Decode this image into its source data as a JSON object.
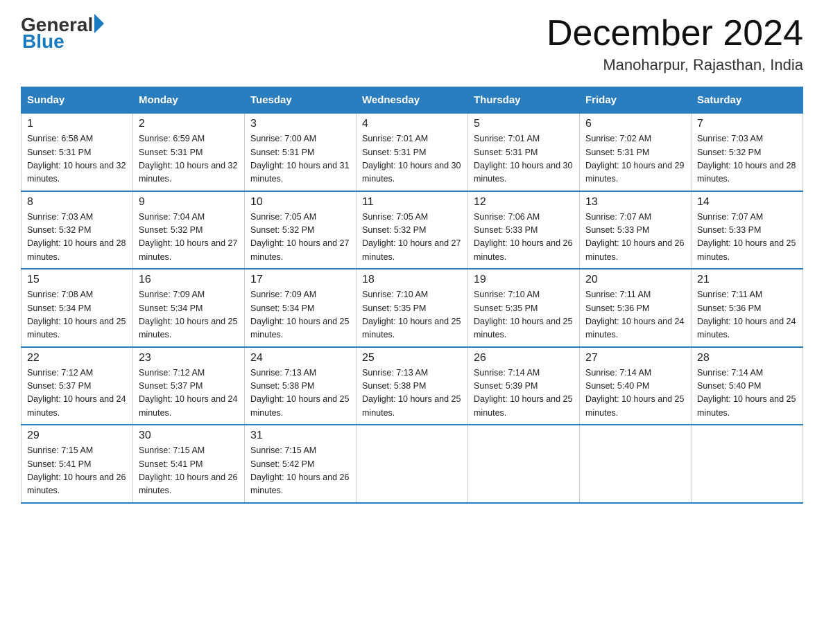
{
  "logo": {
    "general": "General",
    "blue": "Blue"
  },
  "title": "December 2024",
  "subtitle": "Manoharpur, Rajasthan, India",
  "weekdays": [
    "Sunday",
    "Monday",
    "Tuesday",
    "Wednesday",
    "Thursday",
    "Friday",
    "Saturday"
  ],
  "weeks": [
    [
      {
        "day": "1",
        "sunrise": "6:58 AM",
        "sunset": "5:31 PM",
        "daylight": "10 hours and 32 minutes."
      },
      {
        "day": "2",
        "sunrise": "6:59 AM",
        "sunset": "5:31 PM",
        "daylight": "10 hours and 32 minutes."
      },
      {
        "day": "3",
        "sunrise": "7:00 AM",
        "sunset": "5:31 PM",
        "daylight": "10 hours and 31 minutes."
      },
      {
        "day": "4",
        "sunrise": "7:01 AM",
        "sunset": "5:31 PM",
        "daylight": "10 hours and 30 minutes."
      },
      {
        "day": "5",
        "sunrise": "7:01 AM",
        "sunset": "5:31 PM",
        "daylight": "10 hours and 30 minutes."
      },
      {
        "day": "6",
        "sunrise": "7:02 AM",
        "sunset": "5:31 PM",
        "daylight": "10 hours and 29 minutes."
      },
      {
        "day": "7",
        "sunrise": "7:03 AM",
        "sunset": "5:32 PM",
        "daylight": "10 hours and 28 minutes."
      }
    ],
    [
      {
        "day": "8",
        "sunrise": "7:03 AM",
        "sunset": "5:32 PM",
        "daylight": "10 hours and 28 minutes."
      },
      {
        "day": "9",
        "sunrise": "7:04 AM",
        "sunset": "5:32 PM",
        "daylight": "10 hours and 27 minutes."
      },
      {
        "day": "10",
        "sunrise": "7:05 AM",
        "sunset": "5:32 PM",
        "daylight": "10 hours and 27 minutes."
      },
      {
        "day": "11",
        "sunrise": "7:05 AM",
        "sunset": "5:32 PM",
        "daylight": "10 hours and 27 minutes."
      },
      {
        "day": "12",
        "sunrise": "7:06 AM",
        "sunset": "5:33 PM",
        "daylight": "10 hours and 26 minutes."
      },
      {
        "day": "13",
        "sunrise": "7:07 AM",
        "sunset": "5:33 PM",
        "daylight": "10 hours and 26 minutes."
      },
      {
        "day": "14",
        "sunrise": "7:07 AM",
        "sunset": "5:33 PM",
        "daylight": "10 hours and 25 minutes."
      }
    ],
    [
      {
        "day": "15",
        "sunrise": "7:08 AM",
        "sunset": "5:34 PM",
        "daylight": "10 hours and 25 minutes."
      },
      {
        "day": "16",
        "sunrise": "7:09 AM",
        "sunset": "5:34 PM",
        "daylight": "10 hours and 25 minutes."
      },
      {
        "day": "17",
        "sunrise": "7:09 AM",
        "sunset": "5:34 PM",
        "daylight": "10 hours and 25 minutes."
      },
      {
        "day": "18",
        "sunrise": "7:10 AM",
        "sunset": "5:35 PM",
        "daylight": "10 hours and 25 minutes."
      },
      {
        "day": "19",
        "sunrise": "7:10 AM",
        "sunset": "5:35 PM",
        "daylight": "10 hours and 25 minutes."
      },
      {
        "day": "20",
        "sunrise": "7:11 AM",
        "sunset": "5:36 PM",
        "daylight": "10 hours and 24 minutes."
      },
      {
        "day": "21",
        "sunrise": "7:11 AM",
        "sunset": "5:36 PM",
        "daylight": "10 hours and 24 minutes."
      }
    ],
    [
      {
        "day": "22",
        "sunrise": "7:12 AM",
        "sunset": "5:37 PM",
        "daylight": "10 hours and 24 minutes."
      },
      {
        "day": "23",
        "sunrise": "7:12 AM",
        "sunset": "5:37 PM",
        "daylight": "10 hours and 24 minutes."
      },
      {
        "day": "24",
        "sunrise": "7:13 AM",
        "sunset": "5:38 PM",
        "daylight": "10 hours and 25 minutes."
      },
      {
        "day": "25",
        "sunrise": "7:13 AM",
        "sunset": "5:38 PM",
        "daylight": "10 hours and 25 minutes."
      },
      {
        "day": "26",
        "sunrise": "7:14 AM",
        "sunset": "5:39 PM",
        "daylight": "10 hours and 25 minutes."
      },
      {
        "day": "27",
        "sunrise": "7:14 AM",
        "sunset": "5:40 PM",
        "daylight": "10 hours and 25 minutes."
      },
      {
        "day": "28",
        "sunrise": "7:14 AM",
        "sunset": "5:40 PM",
        "daylight": "10 hours and 25 minutes."
      }
    ],
    [
      {
        "day": "29",
        "sunrise": "7:15 AM",
        "sunset": "5:41 PM",
        "daylight": "10 hours and 26 minutes."
      },
      {
        "day": "30",
        "sunrise": "7:15 AM",
        "sunset": "5:41 PM",
        "daylight": "10 hours and 26 minutes."
      },
      {
        "day": "31",
        "sunrise": "7:15 AM",
        "sunset": "5:42 PM",
        "daylight": "10 hours and 26 minutes."
      },
      null,
      null,
      null,
      null
    ]
  ],
  "labels": {
    "sunrise": "Sunrise:",
    "sunset": "Sunset:",
    "daylight": "Daylight:"
  }
}
